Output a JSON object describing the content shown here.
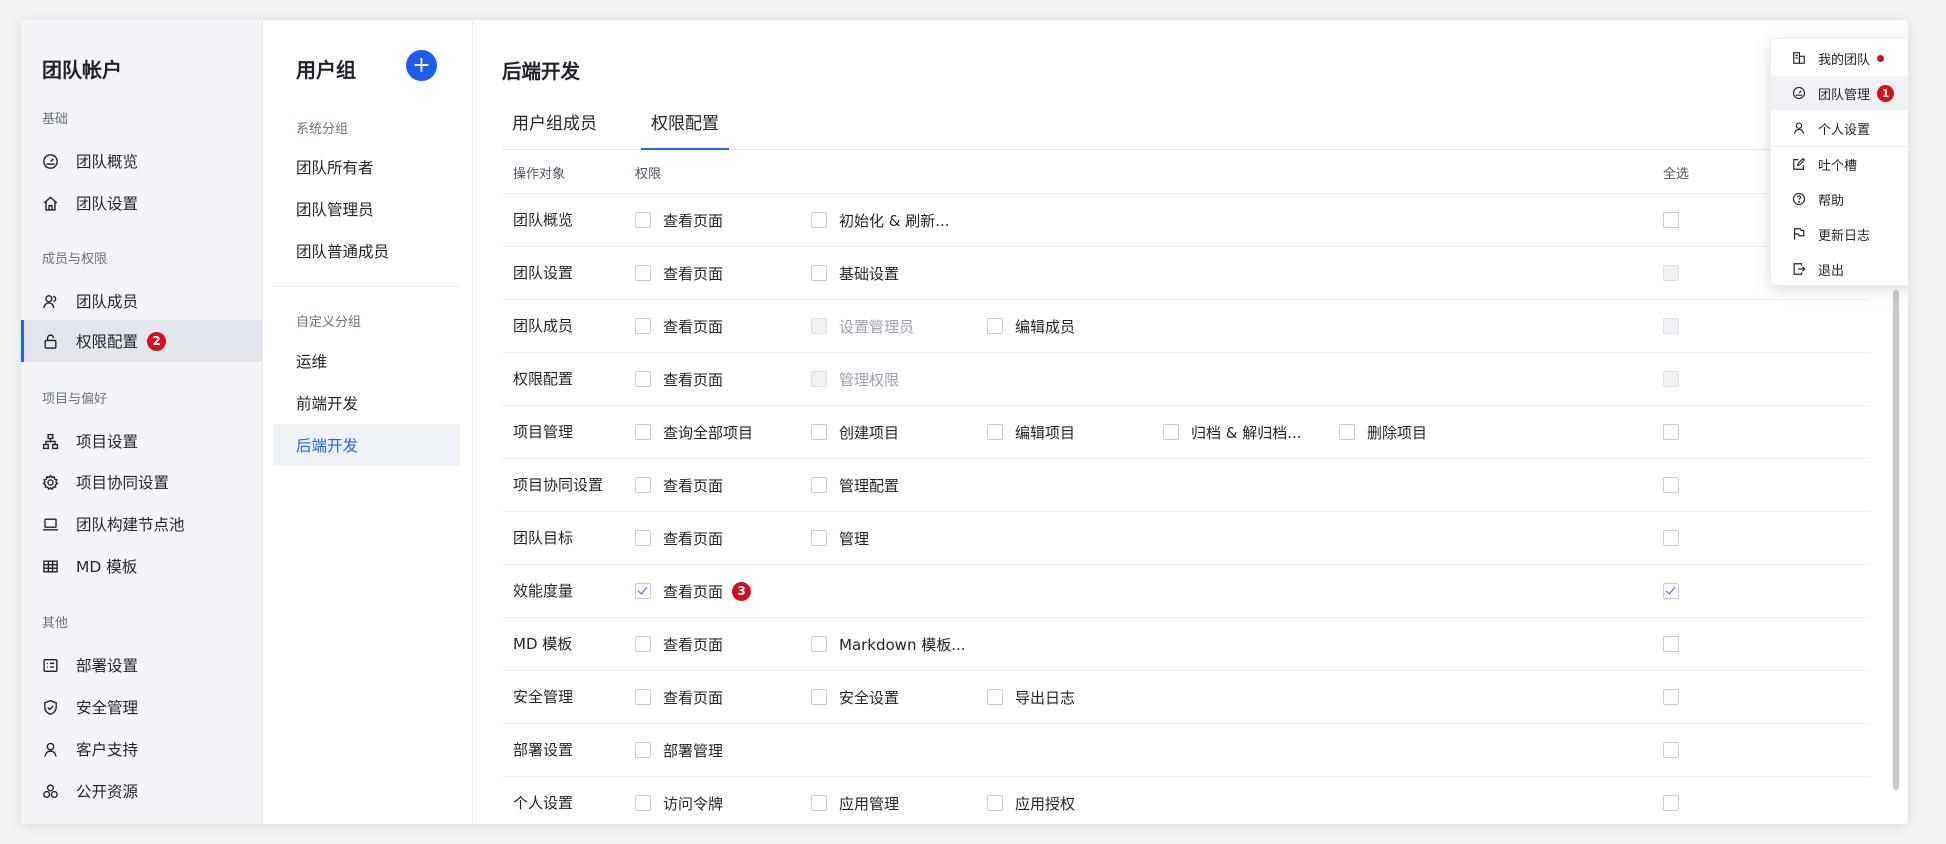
{
  "sidebar": {
    "title": "团队帐户",
    "sections": [
      {
        "label": "基础",
        "items": [
          {
            "label": "团队概览",
            "icon": "dashboard-icon"
          },
          {
            "label": "团队设置",
            "icon": "home-icon"
          }
        ]
      },
      {
        "label": "成员与权限",
        "items": [
          {
            "label": "团队成员",
            "icon": "members-icon"
          },
          {
            "label": "权限配置",
            "icon": "lock-icon",
            "active": true,
            "badge": "2"
          }
        ]
      },
      {
        "label": "项目与偏好",
        "items": [
          {
            "label": "项目设置",
            "icon": "hierarchy-icon"
          },
          {
            "label": "项目协同设置",
            "icon": "gear-icon"
          },
          {
            "label": "团队构建节点池",
            "icon": "laptop-icon"
          },
          {
            "label": "MD 模板",
            "icon": "table-icon"
          }
        ]
      },
      {
        "label": "其他",
        "items": [
          {
            "label": "部署设置",
            "icon": "deploy-icon"
          },
          {
            "label": "安全管理",
            "icon": "shield-icon"
          },
          {
            "label": "客户支持",
            "icon": "user-icon"
          },
          {
            "label": "公开资源",
            "icon": "resources-icon"
          }
        ]
      }
    ]
  },
  "groups": {
    "title": "用户组",
    "add_label": "+",
    "system_label": "系统分组",
    "system": [
      "团队所有者",
      "团队管理员",
      "团队普通成员"
    ],
    "custom_label": "自定义分组",
    "custom": [
      "运维",
      "前端开发",
      "后端开发"
    ],
    "active": "后端开发"
  },
  "main": {
    "title": "后端开发",
    "tabs": [
      {
        "label": "用户组成员",
        "active": false
      },
      {
        "label": "权限配置",
        "active": true
      }
    ],
    "table": {
      "col_target": "操作对象",
      "col_perm": "权限",
      "col_all": "全选",
      "rows": [
        {
          "name": "团队概览",
          "perms": [
            {
              "label": "查看页面"
            },
            {
              "label": "初始化 & 刷新..."
            }
          ],
          "all": "unchecked"
        },
        {
          "name": "团队设置",
          "perms": [
            {
              "label": "查看页面"
            },
            {
              "label": "基础设置"
            }
          ],
          "all": "disabled"
        },
        {
          "name": "团队成员",
          "perms": [
            {
              "label": "查看页面"
            },
            {
              "label": "设置管理员",
              "disabled": true
            },
            {
              "label": "编辑成员"
            }
          ],
          "all": "disabled"
        },
        {
          "name": "权限配置",
          "perms": [
            {
              "label": "查看页面"
            },
            {
              "label": "管理权限",
              "disabled": true
            }
          ],
          "all": "disabled"
        },
        {
          "name": "项目管理",
          "perms": [
            {
              "label": "查询全部项目"
            },
            {
              "label": "创建项目"
            },
            {
              "label": "编辑项目"
            },
            {
              "label": "归档 & 解归档..."
            },
            {
              "label": "删除项目"
            }
          ],
          "all": "unchecked"
        },
        {
          "name": "项目协同设置",
          "perms": [
            {
              "label": "查看页面"
            },
            {
              "label": "管理配置"
            }
          ],
          "all": "unchecked"
        },
        {
          "name": "团队目标",
          "perms": [
            {
              "label": "查看页面"
            },
            {
              "label": "管理"
            }
          ],
          "all": "unchecked"
        },
        {
          "name": "效能度量",
          "perms": [
            {
              "label": "查看页面",
              "checked": true,
              "badge": "3"
            }
          ],
          "all": "checked"
        },
        {
          "name": "MD 模板",
          "perms": [
            {
              "label": "查看页面"
            },
            {
              "label": "Markdown 模板..."
            }
          ],
          "all": "unchecked"
        },
        {
          "name": "安全管理",
          "perms": [
            {
              "label": "查看页面"
            },
            {
              "label": "安全设置"
            },
            {
              "label": "导出日志"
            }
          ],
          "all": "unchecked"
        },
        {
          "name": "部署设置",
          "perms": [
            {
              "label": "部署管理"
            }
          ],
          "all": "unchecked"
        },
        {
          "name": "个人设置",
          "perms": [
            {
              "label": "访问令牌"
            },
            {
              "label": "应用管理"
            },
            {
              "label": "应用授权"
            }
          ],
          "all": "unchecked"
        }
      ]
    }
  },
  "dropdown": {
    "items": [
      {
        "label": "我的团队",
        "icon": "team-icon",
        "dot": true
      },
      {
        "label": "团队管理",
        "icon": "gauge-icon",
        "badge": "1",
        "active": true
      },
      {
        "label": "个人设置",
        "icon": "user-icon"
      },
      {
        "label": "吐个槽",
        "icon": "edit-icon"
      },
      {
        "label": "帮助",
        "icon": "help-icon"
      },
      {
        "label": "更新日志",
        "icon": "flag-icon"
      },
      {
        "label": "退出",
        "icon": "logout-icon"
      }
    ]
  },
  "colors": {
    "accent": "#2563eb",
    "badge": "#d30f1a",
    "sidebar_bg": "#f4f5f8"
  }
}
